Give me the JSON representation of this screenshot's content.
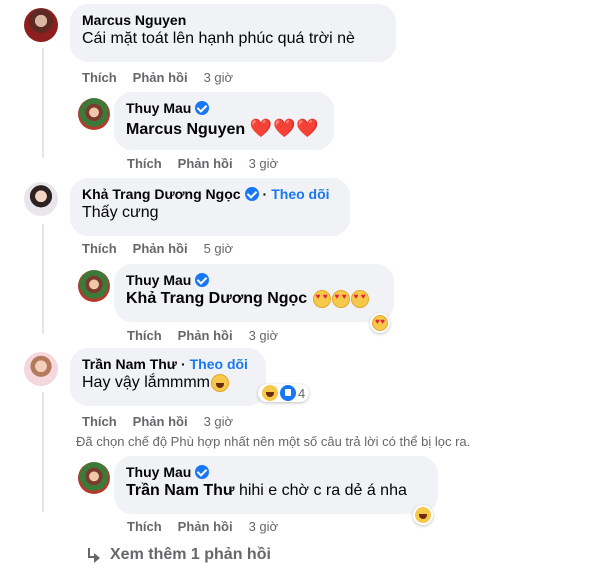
{
  "comments": [
    {
      "name": "Marcus Nguyen",
      "text": "Cái mặt toát lên hạnh phúc quá trời nè",
      "like": "Thích",
      "reply": "Phản hồi",
      "time": "3 giờ"
    },
    {
      "name": "Thuy Mau",
      "mention": "Marcus Nguyen",
      "text_suffix": "❤️❤️❤️",
      "like": "Thích",
      "reply": "Phản hồi",
      "time": "3 giờ"
    },
    {
      "name": "Khả Trang Dương Ngọc",
      "follow": "Theo dõi",
      "text": "Thấy cưng",
      "like": "Thích",
      "reply": "Phản hồi",
      "time": "5 giờ"
    },
    {
      "name": "Thuy Mau",
      "mention": "Khả Trang Dương Ngọc",
      "like": "Thích",
      "reply": "Phản hồi",
      "time": "3 giờ",
      "reaction": "heart-eyes"
    },
    {
      "name": "Trần Nam Thư",
      "follow": "Theo dõi",
      "text": "Hay vậy lắmmmm",
      "like": "Thích",
      "reply": "Phản hồi",
      "time": "3 giờ",
      "reaction_count": "4"
    },
    {
      "name": "Thuy Mau",
      "mention": "Trần Nam Thư",
      "text": " hihi e chờ c ra dẻ á nha",
      "like": "Thích",
      "reply": "Phản hồi",
      "time": "3 giờ",
      "reaction": "haha"
    }
  ],
  "filter_notice": "Đã chọn chế độ Phù hợp nhất nên một số câu trả lời có thể bị lọc ra.",
  "more_replies": "Xem thêm 1 phản hồi",
  "colors": {
    "bubble": "#f0f2f5",
    "link": "#1877f2",
    "meta": "#65676b",
    "heart": "#e41e3f"
  }
}
